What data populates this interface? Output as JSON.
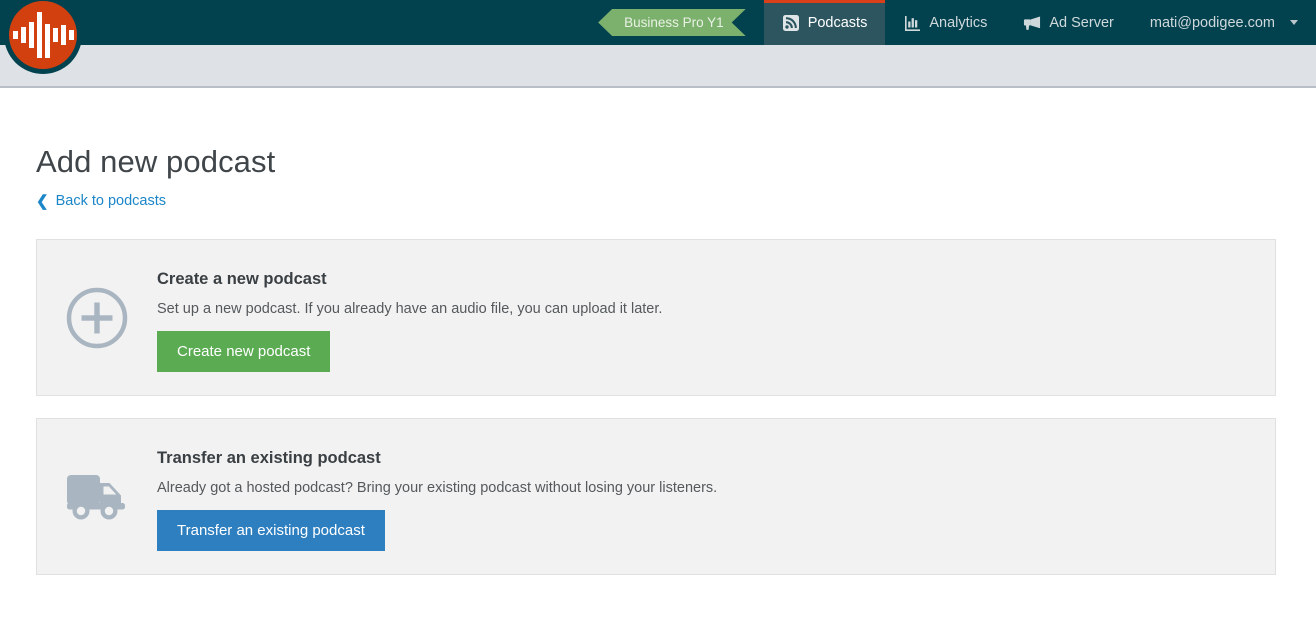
{
  "topnav": {
    "plan_badge": "Business Pro Y1",
    "items": [
      {
        "label": "Podcasts",
        "icon": "rss-icon",
        "active": true
      },
      {
        "label": "Analytics",
        "icon": "bar-chart-icon",
        "active": false
      },
      {
        "label": "Ad Server",
        "icon": "megaphone-icon",
        "active": false
      }
    ],
    "account": {
      "email": "mati@podigee.com",
      "caret_icon": "chevron-down-icon"
    },
    "logo": {
      "name": "podigee-logo",
      "bars": [
        8,
        16,
        26,
        46,
        34,
        14,
        20,
        10
      ],
      "ring_color": "#02414e",
      "disc_color": "#d3400f"
    },
    "colors": {
      "bar_background": "#02414e",
      "active_tab_background": "#2c5560",
      "active_tab_accent": "#d9401a",
      "badge_background": "#7cb06d",
      "subbar_background": "#dee2e6"
    }
  },
  "page": {
    "title": "Add new podcast",
    "back_link": "Back to podcasts",
    "back_link_icon": "chevron-left-icon"
  },
  "cards": [
    {
      "id": "create",
      "icon": "plus-circle-icon",
      "heading": "Create a new podcast",
      "description": "Set up a new podcast. If you already have an audio file, you can upload it later.",
      "button_label": "Create new podcast",
      "button_color": "#5aab52"
    },
    {
      "id": "transfer",
      "icon": "delivery-truck-icon",
      "heading": "Transfer an existing podcast",
      "description": "Already got a hosted podcast? Bring your existing podcast without losing your listeners.",
      "button_label": "Transfer an existing podcast",
      "button_color": "#2e7fc0"
    }
  ]
}
